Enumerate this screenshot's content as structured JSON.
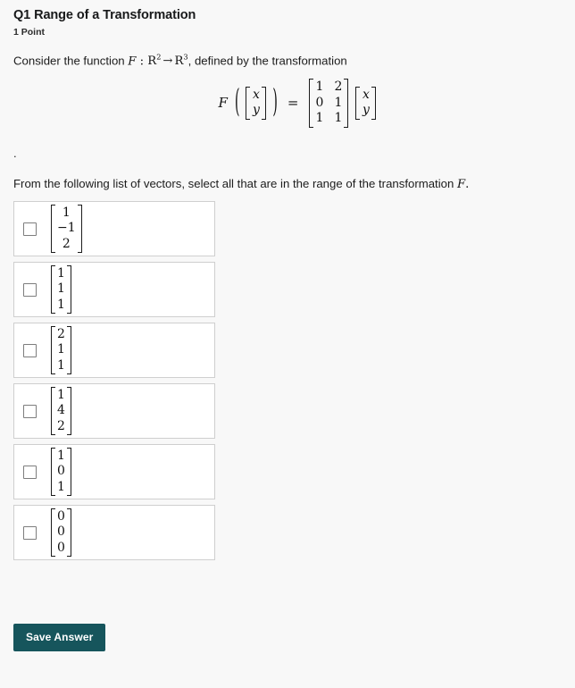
{
  "question": {
    "title": "Q1 Range of a Transformation",
    "points": "1 Point",
    "intro_prefix": "Consider the function ",
    "function_name": "F",
    "colon": " : ",
    "domain_symbol": "R",
    "domain_exponent": "2",
    "arrow": "→",
    "codomain_symbol": "R",
    "codomain_exponent": "3",
    "intro_suffix": ",  defined by the transformation",
    "stray_period": ".",
    "instruction": "From the following list of vectors, select all that are in the range of the transformation",
    "instruction_math": "F",
    "instruction_period": "."
  },
  "equation": {
    "fn": "F",
    "open_paren": "(",
    "close_paren": ")",
    "equals": "=",
    "input_vector": [
      "x",
      "y"
    ],
    "matrix": [
      [
        "1",
        "2"
      ],
      [
        "0",
        "1"
      ],
      [
        "1",
        "1"
      ]
    ],
    "output_vector": [
      "x",
      "y"
    ]
  },
  "options": [
    {
      "id": "option-1",
      "checked": false,
      "vector": [
        "1",
        "−1",
        "2"
      ]
    },
    {
      "id": "option-2",
      "checked": false,
      "vector": [
        "1",
        "1",
        "1"
      ]
    },
    {
      "id": "option-3",
      "checked": false,
      "vector": [
        "2",
        "1",
        "1"
      ]
    },
    {
      "id": "option-4",
      "checked": false,
      "vector": [
        "1",
        "4",
        "2"
      ]
    },
    {
      "id": "option-5",
      "checked": false,
      "vector": [
        "1",
        "0",
        "1"
      ]
    },
    {
      "id": "option-6",
      "checked": false,
      "vector": [
        "0",
        "0",
        "0"
      ]
    }
  ],
  "actions": {
    "save_label": "Save Answer"
  },
  "colors": {
    "page_background": "#f8f8f8",
    "card_background": "#ffffff",
    "card_border": "#cfcfcf",
    "button_background": "#16555c",
    "button_text": "#ffffff",
    "text": "#1c1c1c"
  }
}
